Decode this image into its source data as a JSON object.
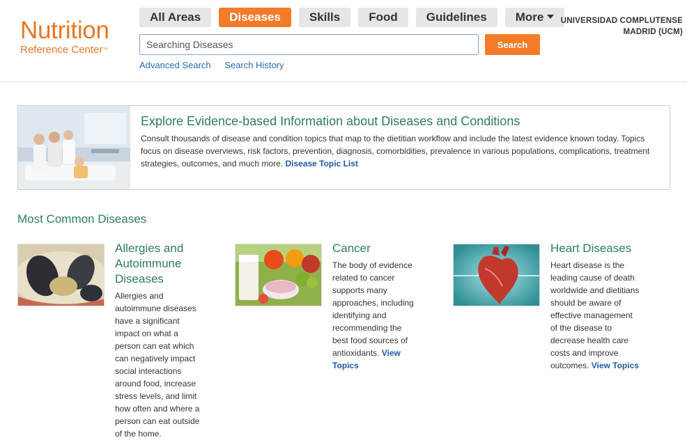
{
  "logo": {
    "line1": "Nutrition",
    "line2": "Reference Center",
    "tm": "™"
  },
  "tabs": [
    {
      "label": "All Areas",
      "active": false
    },
    {
      "label": "Diseases",
      "active": true
    },
    {
      "label": "Skills",
      "active": false
    },
    {
      "label": "Food",
      "active": false
    },
    {
      "label": "Guidelines",
      "active": false
    },
    {
      "label": "More",
      "active": false
    }
  ],
  "search": {
    "placeholder": "Searching Diseases",
    "button": "Search"
  },
  "sub_links": {
    "advanced": "Advanced Search",
    "history": "Search History"
  },
  "institution": {
    "line1": "UNIVERSIDAD COMPLUTENSE",
    "line2": "MADRID (UCM)"
  },
  "banner": {
    "title": "Explore Evidence-based Information about Diseases and Conditions",
    "text": "Consult thousands of disease and condition topics that map to the dietitian workflow and include the latest evidence known today. Topics focus on disease overviews, risk factors, prevention, diagnosis, comorbidities, prevalence in various populations, complications, treatment strategies, outcomes, and much more.",
    "link": "Disease Topic List"
  },
  "section_title": "Most Common Diseases",
  "cards": [
    {
      "title": "Allergies and Autoimmune Diseases",
      "text": "Allergies and autoimmune diseases have a significant impact on what a person can eat which can negatively impact social interactions around food, increase stress levels, and limit how often and where a person can eat outside of the home.",
      "link": ""
    },
    {
      "title": "Cancer",
      "text": "The body of evidence related to cancer supports many approaches, including identifying and recommending the best food sources of antioxidants.",
      "link": "View Topics"
    },
    {
      "title": "Heart Diseases",
      "text": "Heart disease is the leading cause of death worldwide and dietitians should be aware of effective management of the disease to decrease health care costs and improve outcomes.",
      "link": "View Topics"
    }
  ],
  "colors": {
    "accent": "#f47b2a",
    "heading": "#2e7d5e",
    "link": "#1f5aa6"
  }
}
